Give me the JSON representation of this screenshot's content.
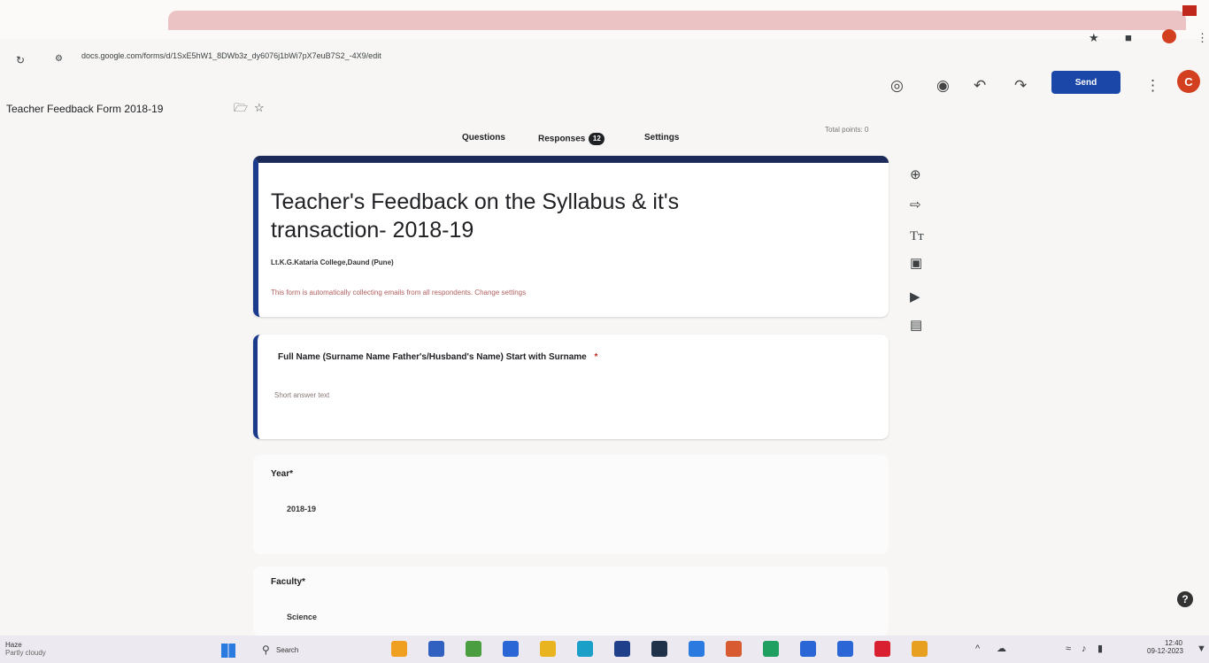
{
  "browser": {
    "url": "docs.google.com/forms/d/1SxE5hW1_8DWb3z_dy6076j1bWi7pX7euB7S2_-4X9/edit",
    "icons": [
      "reload-icon",
      "site-info-icon",
      "bookmark-star-icon",
      "extension-icon",
      "profile-icon",
      "menu-icon"
    ]
  },
  "form_header": {
    "doc_title": "Teacher Feedback Form 2018-19",
    "send_label": "Send",
    "avatar_letter": "C",
    "tabs": [
      {
        "label": "Questions"
      },
      {
        "label": "Responses",
        "badge": "12"
      },
      {
        "label": "Settings"
      }
    ],
    "total_points": "Total points: 0"
  },
  "form": {
    "title": "Teacher's Feedback on the Syllabus & it's transaction-  2018-19",
    "subtitle": "Lt.K.G.Kataria College,Daund (Pune)",
    "email_notice": "This form is automatically collecting emails from all respondents.  Change settings",
    "questions": [
      {
        "label": "Full Name (Surname Name Father's/Husband's Name) Start with Surname",
        "required": "*",
        "placeholder": "Short answer text"
      },
      {
        "label": "Year",
        "required": "*",
        "value": "2018-19"
      },
      {
        "label": "Faculty",
        "required": "*",
        "value": "Science"
      }
    ]
  },
  "side_toolbar": [
    "add-question-icon",
    "import-questions-icon",
    "add-title-icon",
    "add-image-icon",
    "add-video-icon",
    "add-section-icon"
  ],
  "taskbar": {
    "search_label": "Search",
    "weather": "Haze",
    "weather_sub": "Partly cloudy",
    "time": "12:40",
    "date": "09-12-2023",
    "app_icons_colors": [
      "#f0a020",
      "#3060c0",
      "#4a9e40",
      "#2a66d6",
      "#e8b420",
      "#1aa0c8",
      "#1f3f8a",
      "#20314a",
      "#2a7ae0",
      "#d85a30",
      "#20a060",
      "#2a66d6",
      "#2a66d6",
      "#d82030",
      "#e8a020"
    ]
  },
  "colors": {
    "accent": "#1c2a5a",
    "send": "#1a47a8"
  }
}
